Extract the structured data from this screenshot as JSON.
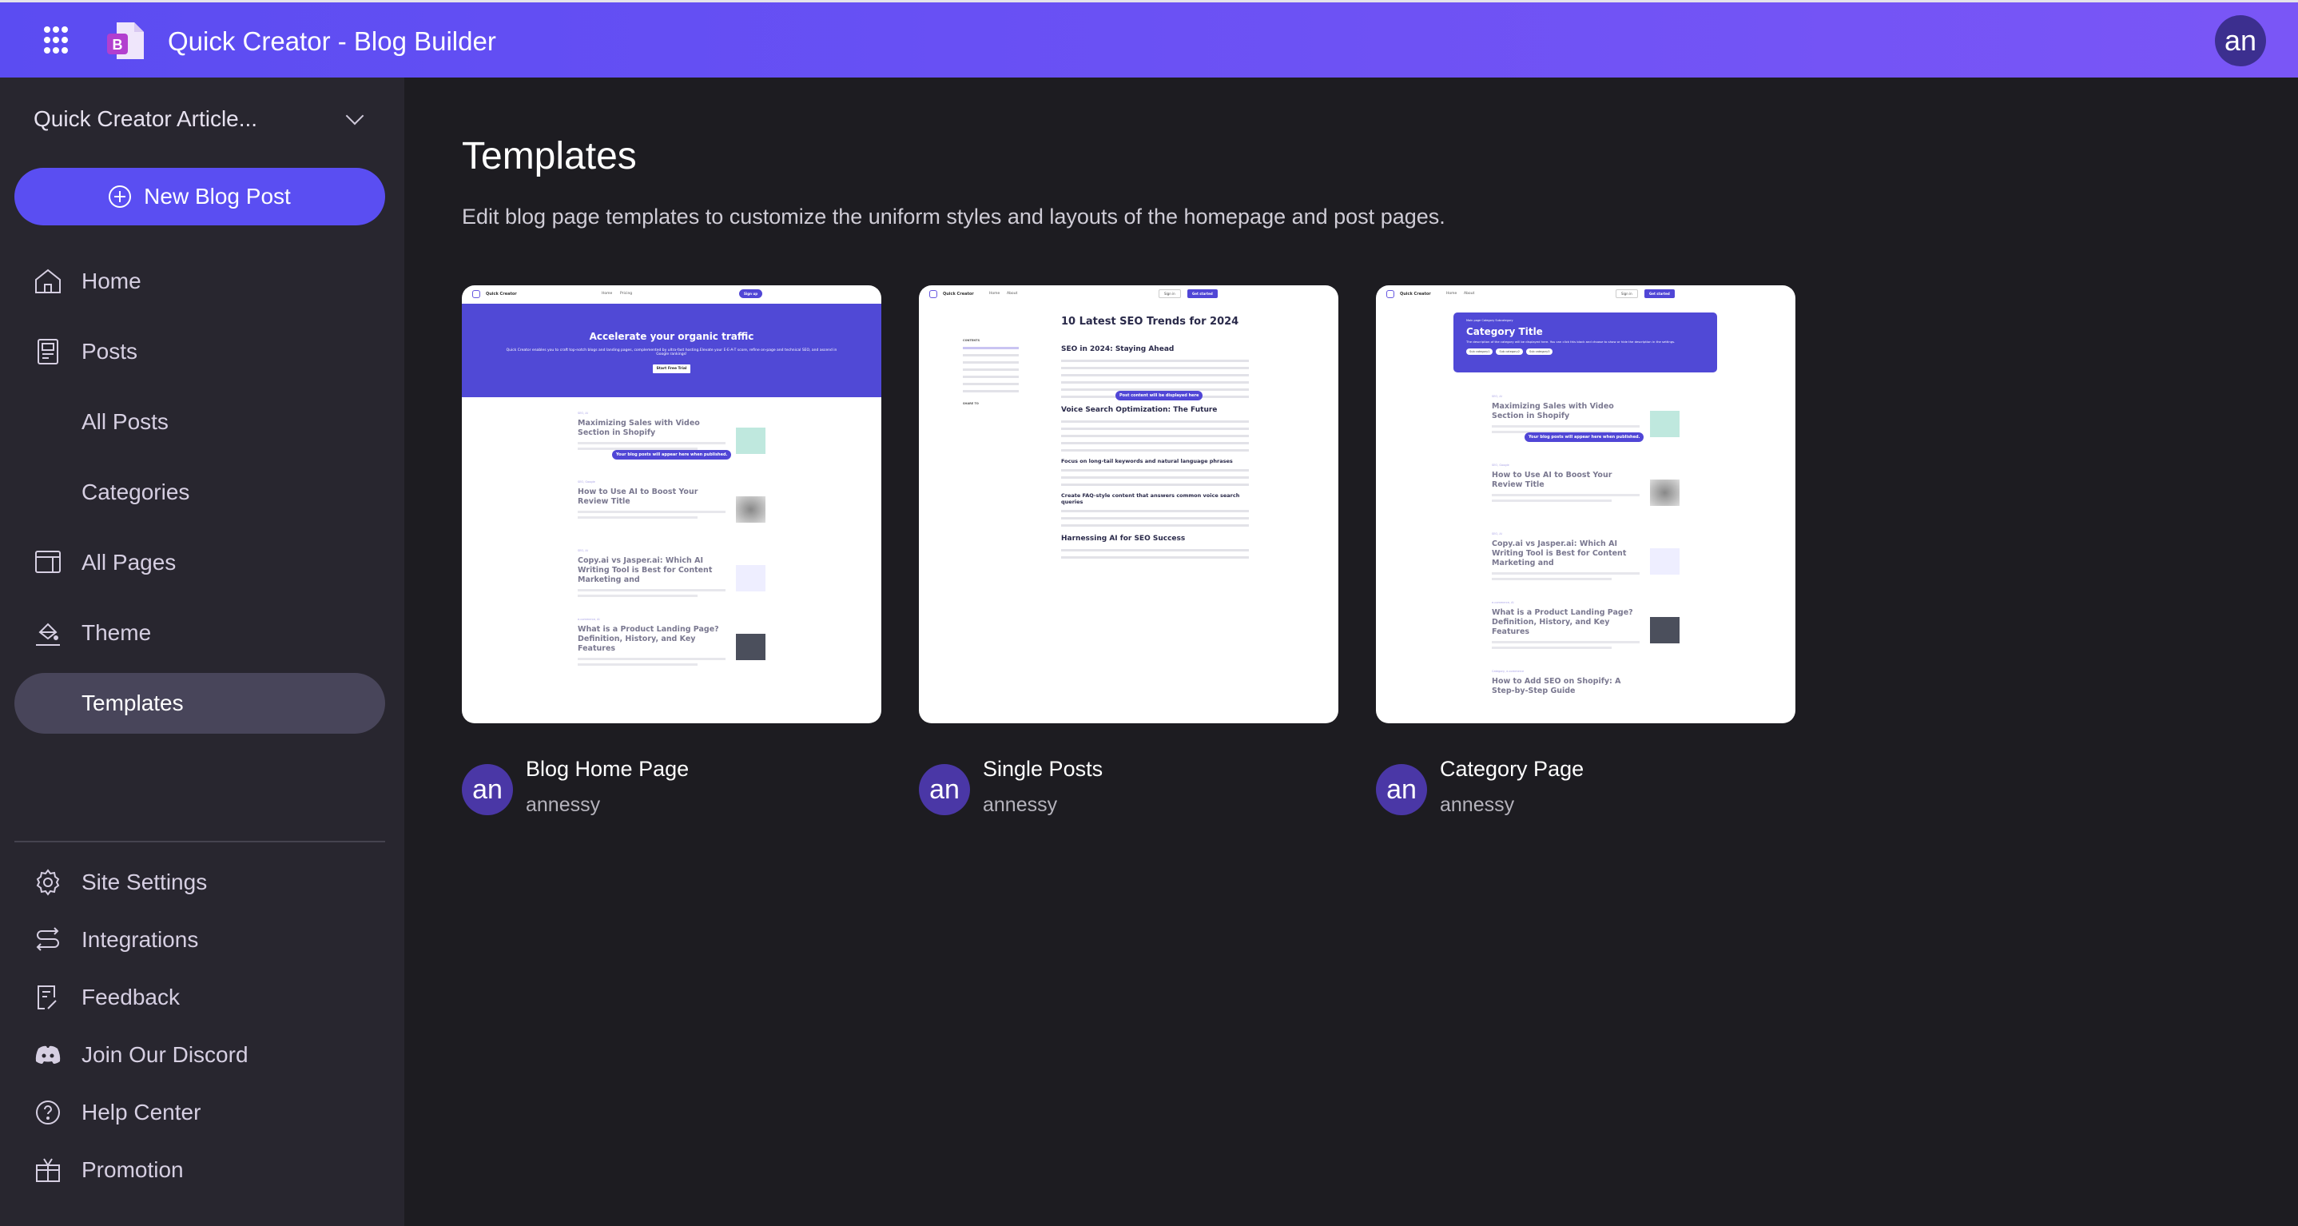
{
  "header": {
    "app_title": "Quick Creator - Blog Builder",
    "avatar_initials": "an",
    "colors": {
      "gradient_start": "#5b4cf2",
      "gradient_end": "#7a56f6"
    }
  },
  "sidebar": {
    "site_selector": "Quick Creator Article...",
    "new_post_label": "New Blog Post",
    "items": [
      {
        "label": "Home",
        "icon": "home-icon"
      },
      {
        "label": "Posts",
        "icon": "posts-icon"
      },
      {
        "label": "All Posts"
      },
      {
        "label": "Categories"
      },
      {
        "label": "All Pages",
        "icon": "pages-icon"
      },
      {
        "label": "Theme",
        "icon": "paint-bucket-icon"
      },
      {
        "label": "Templates",
        "active": true
      }
    ],
    "bottom_items": [
      {
        "label": "Site Settings",
        "icon": "gear-icon"
      },
      {
        "label": "Integrations",
        "icon": "integrations-icon"
      },
      {
        "label": "Feedback",
        "icon": "feedback-icon"
      },
      {
        "label": "Join Our Discord",
        "icon": "discord-icon"
      },
      {
        "label": "Help Center",
        "icon": "help-icon"
      },
      {
        "label": "Promotion",
        "icon": "gift-icon"
      }
    ]
  },
  "main": {
    "title": "Templates",
    "subtitle": "Edit blog page templates to customize the uniform styles and layouts of the homepage and post pages.",
    "templates": [
      {
        "name": "Blog Home Page",
        "author": "annessy",
        "avatar": "an"
      },
      {
        "name": "Single Posts",
        "author": "annessy",
        "avatar": "an"
      },
      {
        "name": "Category Page",
        "author": "annessy",
        "avatar": "an"
      }
    ]
  },
  "previews": {
    "brand": "Quick Creator",
    "nav_home": "Home",
    "nav_pricing": "Pricing",
    "nav_about": "About",
    "sign_up": "Sign up",
    "sign_in": "Sign in",
    "get_started": "Get started",
    "hero_title": "Accelerate your organic traffic",
    "hero_text": "Quick Creator enables you to craft top-notch blogs and landing pages, complemented by ultra-fast hosting.Elevate your E-E-A-T score, refine on-page and technical SEO, and ascend in Google rankings!",
    "hero_button": "Start Free Trial",
    "posts_placeholder": "Your blog posts will appear here when published.",
    "post_titles": [
      "Maximizing Sales with Video Section in Shopify",
      "How to Use AI to Boost Your Review Title",
      "Copy.ai vs Jasper.ai: Which AI Writing Tool is Best for Content Marketing and",
      "What is a Product Landing Page? Definition, History, and Key Features",
      "How to Add SEO on Shopify: A Step-by-Step Guide"
    ],
    "article_title": "10 Latest SEO Trends for 2024",
    "article_h1": "SEO in 2024: Staying Ahead",
    "article_h2": "Voice Search Optimization: The Future",
    "article_h3": "Focus on long-tail keywords and natural language phrases",
    "article_h4": "Create FAQ-style content that answers common voice search queries",
    "article_h5": "Harnessing AI for SEO Success",
    "post_placeholder": "Post content will be displayed here",
    "toc_label": "CONTENTS",
    "share_label": "SHARE TO",
    "breadcrumb": "Main page   Category   Subcategory",
    "category_title": "Category Title",
    "category_desc": "The description of the category will be displayed here. You can click this block and choose to show or hide the description in the settings.",
    "subcategories": [
      "Sub category1",
      "Sub category2",
      "Sub category3"
    ]
  }
}
